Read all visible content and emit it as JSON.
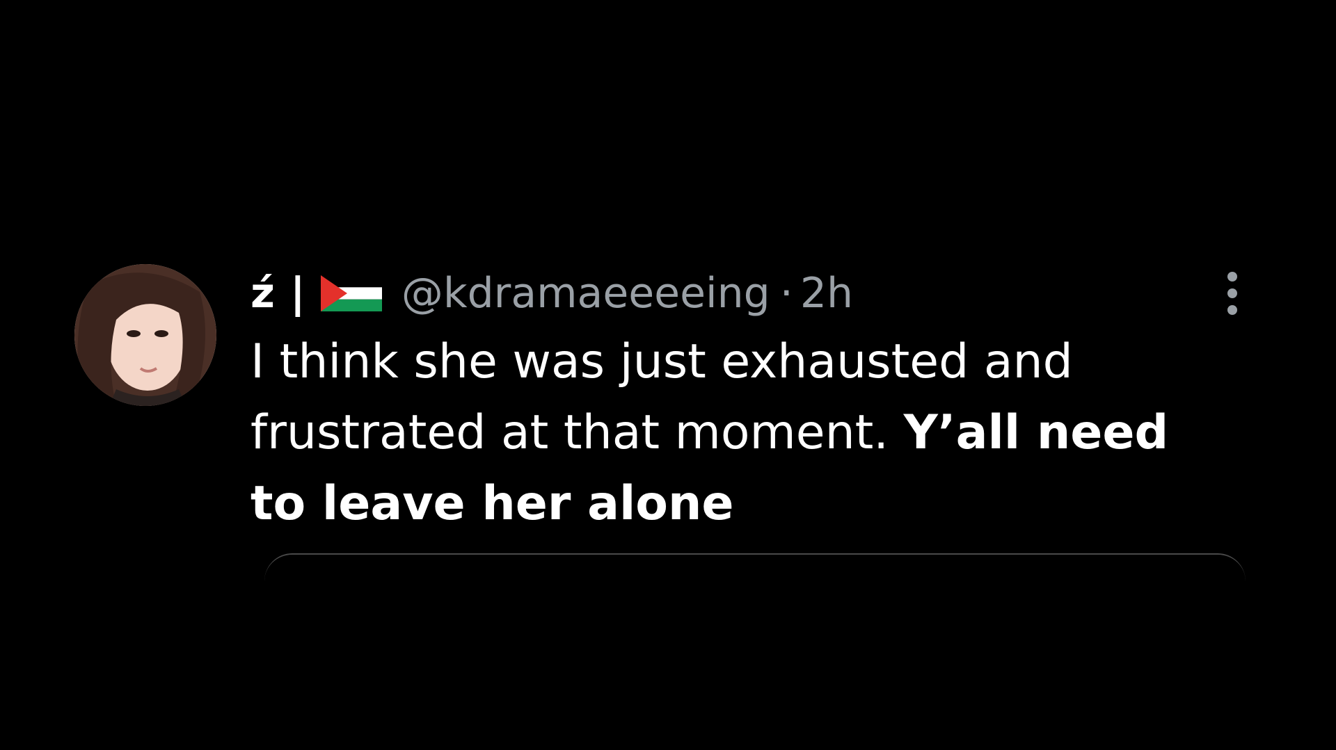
{
  "tweet": {
    "display_name": "ź",
    "separator": "|",
    "flag_icon": "palestine-flag-icon",
    "handle": "@kdramaeeeeing",
    "dot": "·",
    "time": "2h",
    "body_regular": "I think she was just exhausted and frustrated at that moment. ",
    "body_bold": "Y’all need to leave her alone",
    "more_icon": "more-vertical-icon"
  },
  "colors": {
    "background": "#000000",
    "primary_text": "#ffffff",
    "secondary_text": "#9aa0a6",
    "flag_green": "#149954",
    "flag_red": "#e4312b"
  }
}
